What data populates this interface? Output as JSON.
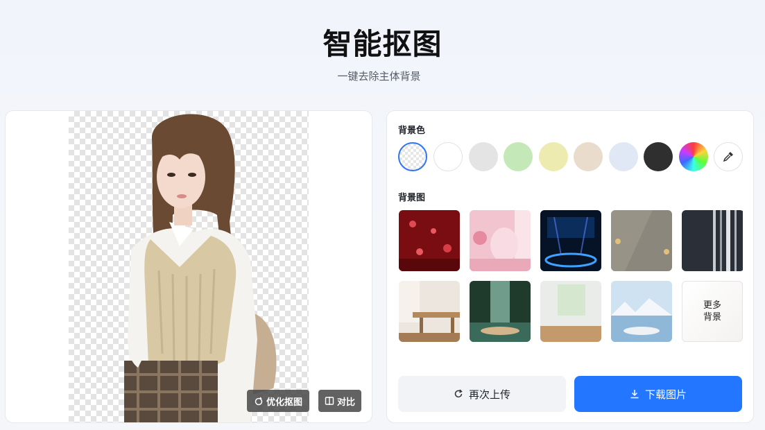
{
  "header": {
    "title": "智能抠图",
    "subtitle": "一键去除主体背景"
  },
  "preview": {
    "refine_label": "优化抠图",
    "compare_label": "对比"
  },
  "panel": {
    "bg_color_label": "背景色",
    "bg_image_label": "背景图",
    "colors": [
      {
        "name": "transparent",
        "value": "transparent"
      },
      {
        "name": "white",
        "value": "#ffffff"
      },
      {
        "name": "light-gray",
        "value": "#e4e4e4"
      },
      {
        "name": "light-green",
        "value": "#c5e8b9"
      },
      {
        "name": "light-yellow",
        "value": "#eeebb0"
      },
      {
        "name": "beige",
        "value": "#eadccd"
      },
      {
        "name": "light-blue",
        "value": "#e1e8f5"
      },
      {
        "name": "dark-gray",
        "value": "#2f2f2f"
      }
    ],
    "more_backgrounds_label": "更多背景",
    "reupload_label": "再次上传",
    "download_label": "下载图片"
  },
  "colors": {
    "accent": "#2376ff",
    "selected_border": "#2f74f5"
  }
}
